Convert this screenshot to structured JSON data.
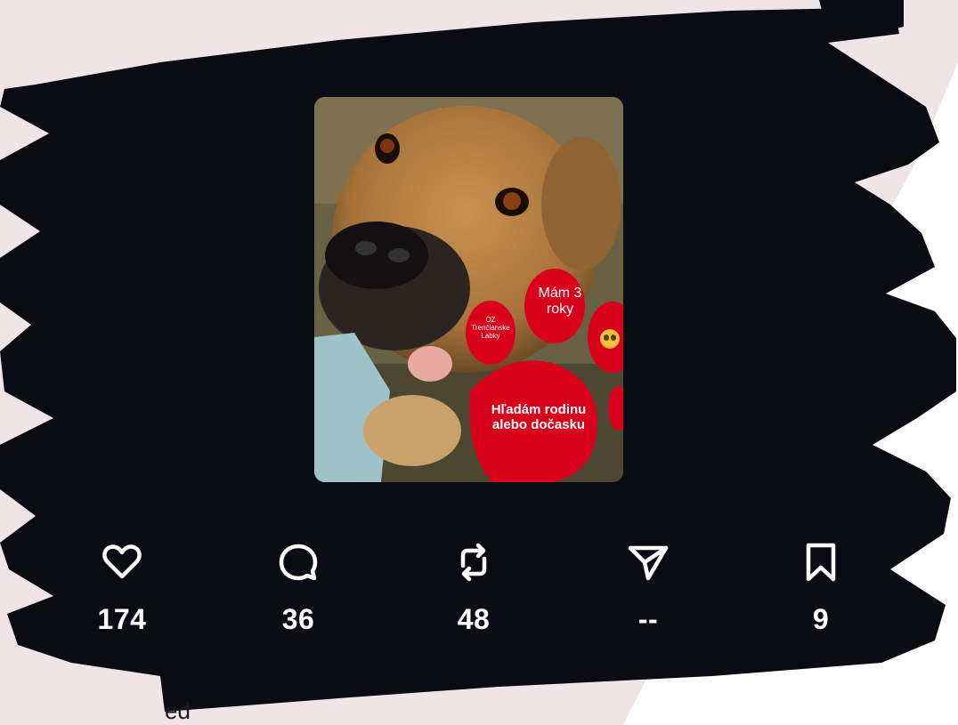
{
  "post": {
    "image": {
      "description_icons": [
        "paw-bubble",
        "paw-bubble",
        "heart-bubble"
      ],
      "overlay_age": "Mám 3 roky",
      "overlay_org": "OZ Trenčianske Labky",
      "overlay_main_line1": "Hľadám rodinu",
      "overlay_main_line2": "alebo dočasku",
      "overlay_emoji": "pleading-face-emoji"
    },
    "actions": {
      "like": {
        "icon": "heart-icon",
        "count": "174"
      },
      "comment": {
        "icon": "comment-icon",
        "count": "36"
      },
      "repost": {
        "icon": "repost-icon",
        "count": "48"
      },
      "share": {
        "icon": "send-icon",
        "count": "--"
      },
      "save": {
        "icon": "bookmark-icon",
        "count": "9"
      }
    },
    "trailing_text": "ed"
  },
  "colors": {
    "background": "#efe4e6",
    "brush": "#0b0b13",
    "accent_red": "#d9001b",
    "text": "#ffffff"
  }
}
